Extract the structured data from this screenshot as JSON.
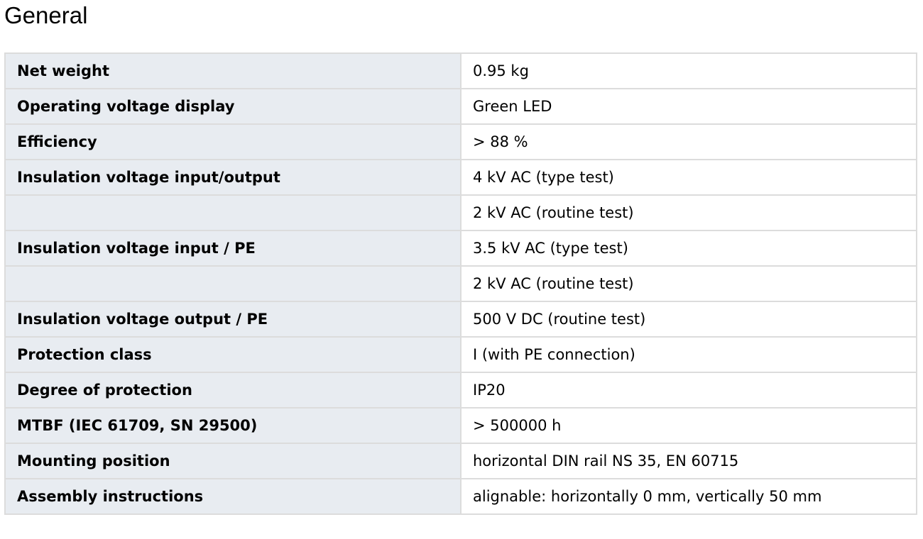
{
  "section": {
    "title": "General"
  },
  "rows": [
    {
      "label": "Net weight",
      "value": "0.95 kg"
    },
    {
      "label": "Operating voltage display",
      "value": "Green LED"
    },
    {
      "label": "Efficiency",
      "value": "> 88 %"
    },
    {
      "label": "Insulation voltage input/output",
      "value": "4 kV AC (type test)"
    },
    {
      "label": "",
      "value": "2 kV AC (routine test)"
    },
    {
      "label": "Insulation voltage input / PE",
      "value": "3.5 kV AC (type test)"
    },
    {
      "label": "",
      "value": "2 kV AC (routine test)"
    },
    {
      "label": "Insulation voltage output / PE",
      "value": "500 V DC (routine test)"
    },
    {
      "label": "Protection class",
      "value": "I (with PE connection)"
    },
    {
      "label": "Degree of protection",
      "value": "IP20"
    },
    {
      "label": "MTBF (IEC 61709, SN 29500)",
      "value": "> 500000 h"
    },
    {
      "label": "Mounting position",
      "value": "horizontal DIN rail NS 35, EN 60715"
    },
    {
      "label": "Assembly instructions",
      "value": "alignable: horizontally 0 mm, vertically 50 mm"
    }
  ]
}
